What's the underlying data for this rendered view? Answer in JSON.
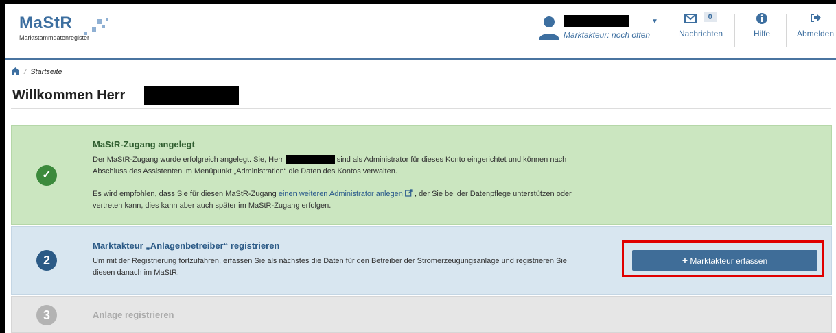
{
  "header": {
    "logo_text": "MaStR",
    "logo_subtitle": "Marktstammdatenregister",
    "user_role": "Marktakteur: noch offen",
    "nav": {
      "messages_label": "Nachrichten",
      "messages_count": "0",
      "help_label": "Hilfe",
      "logout_label": "Abmelden"
    }
  },
  "breadcrumb": {
    "current": "Startseite"
  },
  "page_title": "Willkommen Herr",
  "steps": [
    {
      "number": "✓",
      "title": "MaStR-Zugang angelegt",
      "text1_a": "Der MaStR-Zugang wurde erfolgreich angelegt. Sie, Herr",
      "text1_b": "sind als Administrator für dieses Konto eingerichtet und können nach",
      "text1_c": "Abschluss des Assistenten im Menüpunkt „Administration“ die Daten des Kontos verwalten.",
      "text2_a": "Es wird empfohlen, dass Sie für diesen MaStR-Zugang",
      "link": "einen weiteren Administrator anlegen",
      "text2_b": ", der Sie bei der Datenpflege unterstützen oder",
      "text2_c": "vertreten kann, dies kann aber auch später im MaStR-Zugang erfolgen."
    },
    {
      "number": "2",
      "title": "Marktakteur „Anlagenbetreiber“ registrieren",
      "text_a": "Um mit der Registrierung fortzufahren, erfassen Sie als nächstes die Daten für den Betreiber der Stromerzeugungsanlage und registrieren Sie",
      "text_b": "diesen danach im MaStR.",
      "button": "Marktakteur erfassen"
    },
    {
      "number": "3",
      "title": "Anlage registrieren"
    }
  ],
  "colors": {
    "brand": "#3d6fa0",
    "success_bg": "#cbe6c0",
    "success_icon": "#3c8a3c",
    "active_bg": "#d8e6f0",
    "active_icon": "#2b5a86",
    "disabled_bg": "#e6e6e6",
    "highlight": "#e00000"
  }
}
